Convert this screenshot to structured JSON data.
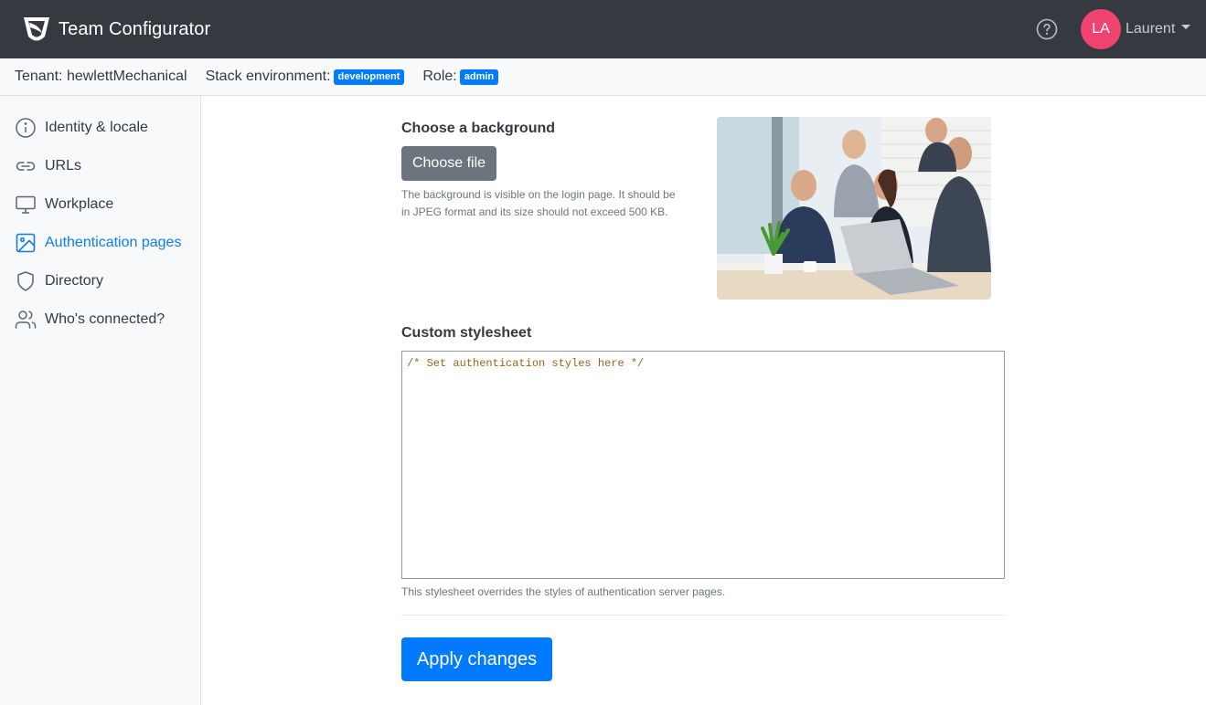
{
  "app": {
    "title": "Team Configurator"
  },
  "user": {
    "initials": "LA",
    "name": "Laurent"
  },
  "context": {
    "tenant_label": "Tenant:",
    "tenant_value": "hewlettMechanical",
    "stack_label": "Stack environment:",
    "stack_badge": "development",
    "role_label": "Role:",
    "role_badge": "admin"
  },
  "sidebar": {
    "items": [
      {
        "label": "Identity & locale",
        "icon": "info-icon"
      },
      {
        "label": "URLs",
        "icon": "link-icon"
      },
      {
        "label": "Workplace",
        "icon": "monitor-icon"
      },
      {
        "label": "Authentication pages",
        "icon": "image-icon",
        "active": true
      },
      {
        "label": "Directory",
        "icon": "shield-icon"
      },
      {
        "label": "Who's connected?",
        "icon": "users-icon"
      }
    ]
  },
  "background": {
    "title": "Choose a background",
    "button_label": "Choose file",
    "help_text": "The background is visible on the login page. It should be in JPEG format and its size should not exceed 500 KB."
  },
  "stylesheet": {
    "title": "Custom stylesheet",
    "value": "/* Set authentication styles here */",
    "help_text": "This stylesheet overrides the styles of authentication server pages."
  },
  "actions": {
    "apply_label": "Apply changes"
  },
  "colors": {
    "navbar": "#343a40",
    "accent": "#007bff",
    "avatar": "#f0436f",
    "secondary_button": "#6c757d"
  }
}
